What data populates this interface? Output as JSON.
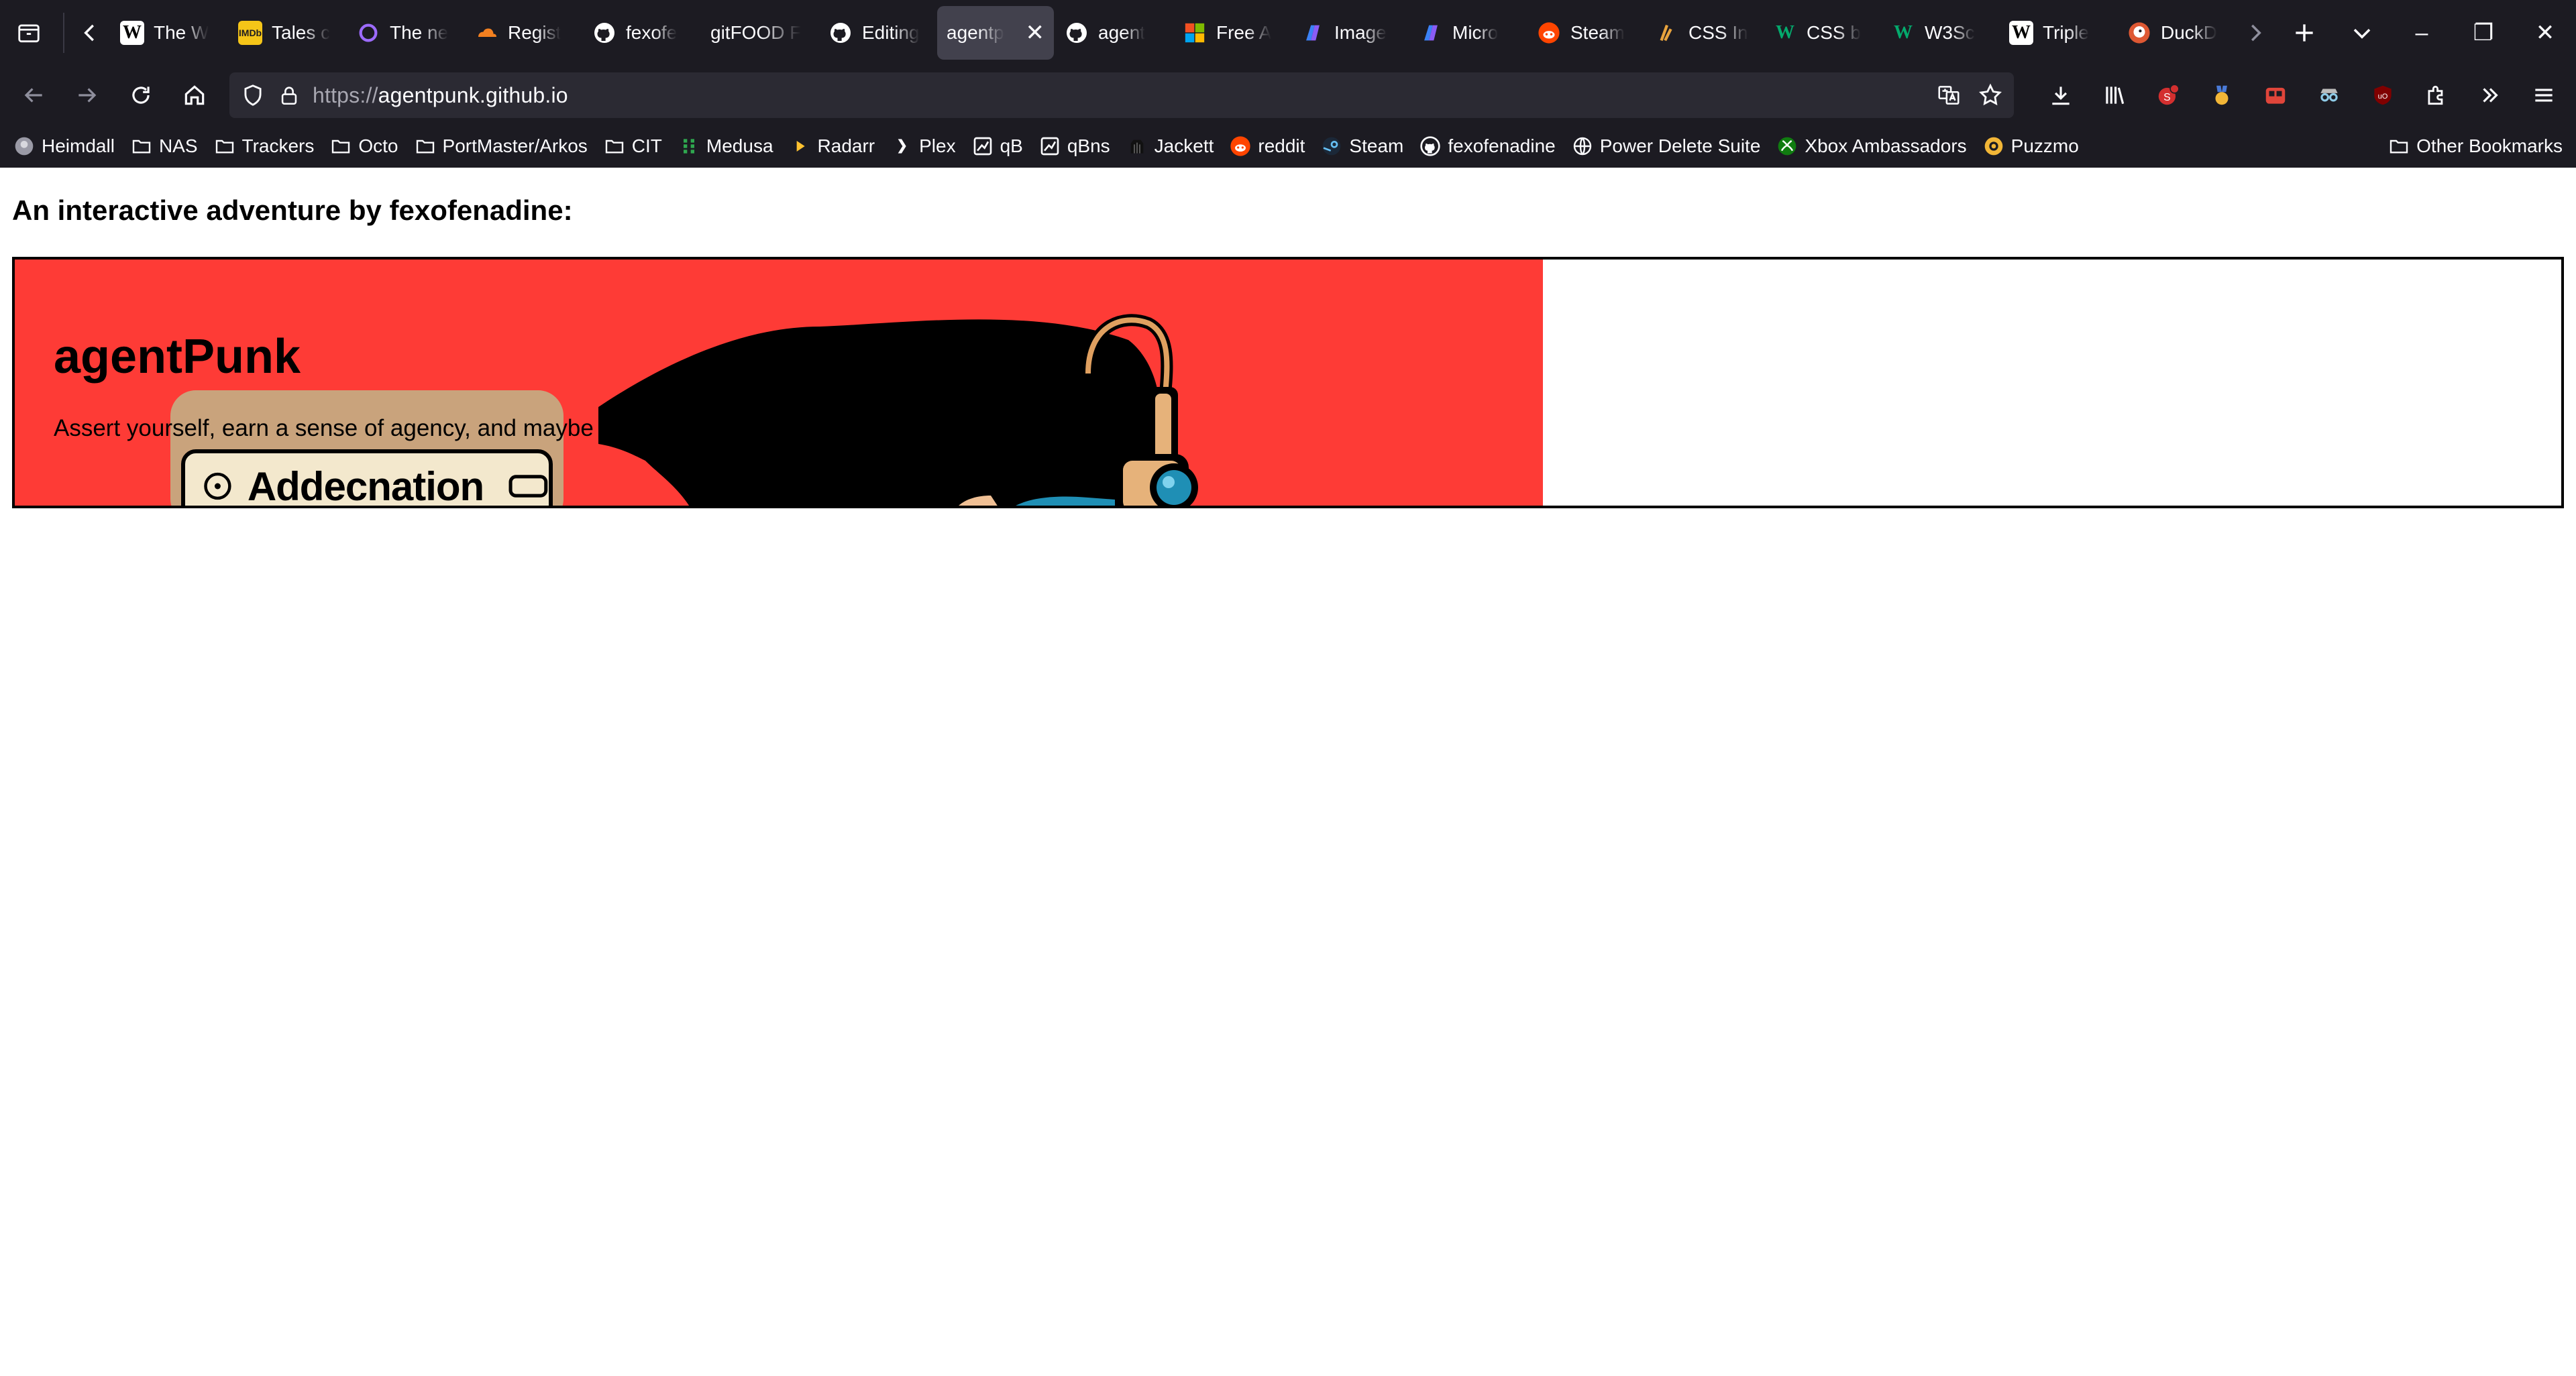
{
  "tabs": [
    {
      "title": "The W",
      "icon": "wikipedia-icon",
      "color": "#ffffff"
    },
    {
      "title": "Tales c",
      "icon": "imdb-icon",
      "color": "#f5c518"
    },
    {
      "title": "The ne",
      "icon": "circle-icon",
      "color": "#9d6bff"
    },
    {
      "title": "Regist",
      "icon": "cloudflare-icon",
      "color": "#f38020"
    },
    {
      "title": "fexofe",
      "icon": "github-icon",
      "color": "#ffffff"
    },
    {
      "title": "gitFOOD F",
      "icon": "",
      "color": ""
    },
    {
      "title": "Editing",
      "icon": "github-icon",
      "color": "#ffffff"
    },
    {
      "title": "agentp",
      "icon": "",
      "color": "",
      "active": true
    },
    {
      "title": "agent",
      "icon": "github-icon",
      "color": "#ffffff"
    },
    {
      "title": "Free A",
      "icon": "microsoft-icon",
      "color": "#f25022"
    },
    {
      "title": "Image",
      "icon": "copilot-icon",
      "color": "#8a5cf6"
    },
    {
      "title": "Micro",
      "icon": "copilot-icon",
      "color": "#8a5cf6"
    },
    {
      "title": "Steam",
      "icon": "reddit-icon",
      "color": "#ff4500"
    },
    {
      "title": "CSS In",
      "icon": "css-icon",
      "color": "#e8a33d"
    },
    {
      "title": "CSS b",
      "icon": "w3schools-icon",
      "color": "#04aa6d"
    },
    {
      "title": "W3Sc",
      "icon": "w3schools-icon",
      "color": "#04aa6d"
    },
    {
      "title": "Triple",
      "icon": "wikipedia-icon",
      "color": "#ffffff"
    },
    {
      "title": "DuckD",
      "icon": "duckduckgo-icon",
      "color": "#de5833"
    }
  ],
  "tab_active_close": "✕",
  "window_controls": {
    "minimize": "–",
    "restore": "❐",
    "close": "✕"
  },
  "url": {
    "prefix": "https://",
    "host": "agentpunk.github.io"
  },
  "bookmarks": [
    {
      "label": "Heimdall",
      "icon": "heimdall-icon"
    },
    {
      "label": "NAS",
      "icon": "folder-icon"
    },
    {
      "label": "Trackers",
      "icon": "folder-icon"
    },
    {
      "label": "Octo",
      "icon": "folder-icon"
    },
    {
      "label": "PortMaster/Arkos",
      "icon": "folder-icon"
    },
    {
      "label": "CIT",
      "icon": "folder-icon"
    },
    {
      "label": "Medusa",
      "icon": "medusa-icon"
    },
    {
      "label": "Radarr",
      "icon": "radarr-icon"
    },
    {
      "label": "Plex",
      "icon": "plex-icon"
    },
    {
      "label": "qB",
      "icon": "qbittorrent-icon"
    },
    {
      "label": "qBns",
      "icon": "qbittorrent-icon"
    },
    {
      "label": "Jackett",
      "icon": "jackett-icon"
    },
    {
      "label": "reddit",
      "icon": "reddit-icon"
    },
    {
      "label": "Steam",
      "icon": "steam-icon"
    },
    {
      "label": "fexofenadine",
      "icon": "github-icon"
    },
    {
      "label": "Power Delete Suite",
      "icon": "globe-icon"
    },
    {
      "label": "Xbox Ambassadors",
      "icon": "xbox-icon"
    },
    {
      "label": "Puzzmo",
      "icon": "puzzmo-icon"
    }
  ],
  "other_bookmarks": "Other Bookmarks",
  "page": {
    "heading": "An interactive adventure by fexofenadine:",
    "hero_title": "agentPunk",
    "hero_subtitle": "Assert yourself, earn a sense of agency, and maybe solve a crime in",
    "badge_text": "Addecnation",
    "colors": {
      "hero_bg": "#fe3b36",
      "badge": "#f3e8cd"
    }
  }
}
